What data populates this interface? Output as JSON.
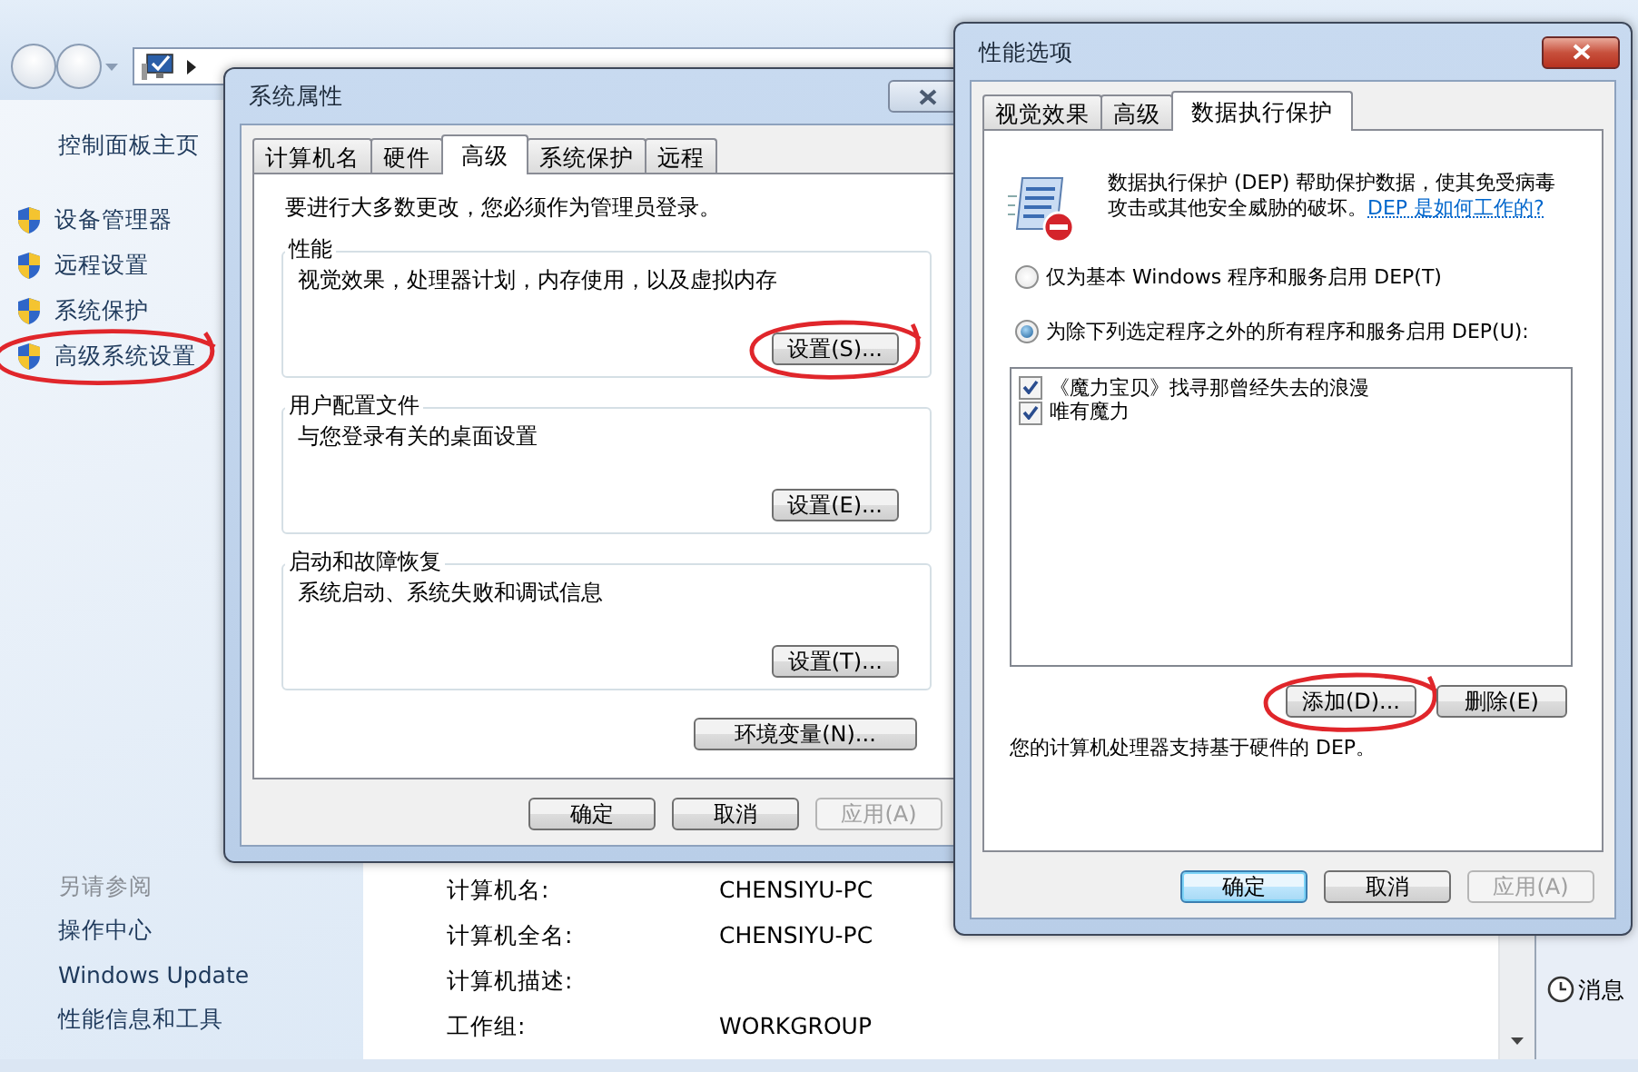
{
  "control_panel": {
    "sidebar": {
      "home": "控制面板主页",
      "tasks": [
        {
          "label": "设备管理器",
          "circled": false
        },
        {
          "label": "远程设置",
          "circled": false
        },
        {
          "label": "系统保护",
          "circled": false
        },
        {
          "label": "高级系统设置",
          "circled": true
        }
      ],
      "see_also_heading": "另请参阅",
      "see_also": [
        "操作中心",
        "Windows Update",
        "性能信息和工具"
      ]
    },
    "info_rows": [
      {
        "label": "计算机名:",
        "value": "CHENSIYU-PC"
      },
      {
        "label": "计算机全名:",
        "value": "CHENSIYU-PC"
      },
      {
        "label": "计算机描述:"
      },
      {
        "label": "工作组:",
        "value": "WORKGROUP"
      }
    ],
    "side_panel": {
      "item": "消息"
    }
  },
  "system_properties": {
    "title": "系统属性",
    "tabs": [
      {
        "label": "计算机名",
        "selected": false
      },
      {
        "label": "硬件",
        "selected": false
      },
      {
        "label": "高级",
        "selected": true
      },
      {
        "label": "系统保护",
        "selected": false
      },
      {
        "label": "远程",
        "selected": false
      }
    ],
    "note": "要进行大多数更改，您必须作为管理员登录。",
    "groups": [
      {
        "title": "性能",
        "description": "视觉效果，处理器计划，内存使用，以及虚拟内存",
        "button": {
          "label": "设置(S)...",
          "circled": true
        }
      },
      {
        "title": "用户配置文件",
        "description": "与您登录有关的桌面设置",
        "button": {
          "label": "设置(E)...",
          "circled": false
        }
      },
      {
        "title": "启动和故障恢复",
        "description": "系统启动、系统失败和调试信息",
        "button": {
          "label": "设置(T)...",
          "circled": false
        }
      }
    ],
    "env_button": {
      "label": "环境变量(N)...",
      "circled": false
    },
    "buttons": [
      {
        "label": "确定",
        "disabled": false,
        "default": false
      },
      {
        "label": "取消",
        "disabled": false,
        "default": false
      },
      {
        "label": "应用(A)",
        "disabled": true,
        "default": false
      }
    ]
  },
  "performance_options": {
    "title": "性能选项",
    "tabs": [
      {
        "label": "视觉效果",
        "selected": false
      },
      {
        "label": "高级",
        "selected": false
      },
      {
        "label": "数据执行保护",
        "selected": true
      }
    ],
    "description": "数据执行保护 (DEP) 帮助保护数据，使其免受病毒攻击或其他安全威胁的破坏。",
    "help_link": "DEP 是如何工作的?",
    "options": [
      {
        "label": "仅为基本 Windows 程序和服务启用 DEP(T)",
        "selected": false
      },
      {
        "label": "为除下列选定程序之外的所有程序和服务启用 DEP(U):",
        "selected": true
      }
    ],
    "programs": [
      {
        "label": "《魔力宝贝》找寻那曾经失去的浪漫",
        "checked": true
      },
      {
        "label": "唯有魔力",
        "checked": true
      }
    ],
    "list_buttons": [
      {
        "label": "添加(D)...",
        "circled": true
      },
      {
        "label": "删除(E)",
        "circled": false
      }
    ],
    "support_note": "您的计算机处理器支持基于硬件的 DEP。",
    "buttons": [
      {
        "label": "确定",
        "disabled": false,
        "default": true
      },
      {
        "label": "取消",
        "disabled": false,
        "default": false
      },
      {
        "label": "应用(A)",
        "disabled": true,
        "default": false
      }
    ]
  }
}
